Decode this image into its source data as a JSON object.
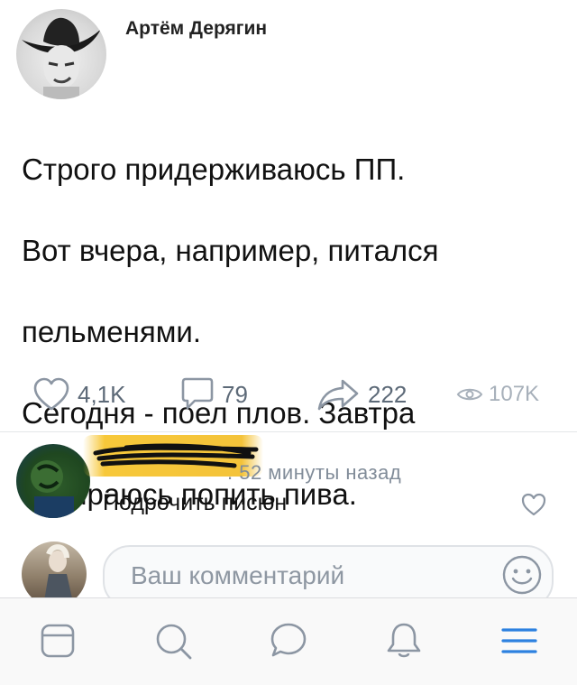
{
  "post": {
    "author": "Артём Дерягин",
    "text_lines": [
      "Строго придерживаюсь ПП.",
      "Вот вчера, например, питался",
      "пельменями.",
      "Сегодня - поел плов. Завтра",
      "собираюсь попить пива."
    ],
    "likes": "4,1K",
    "comments": "79",
    "shares": "222",
    "views": "107K"
  },
  "comment": {
    "time": ". 52 минуты назад",
    "text": "Подрочить писюн"
  },
  "composer": {
    "placeholder": "Ваш комментарий"
  },
  "tabbar": {
    "items": [
      "news-icon",
      "search-icon",
      "messages-icon",
      "notifications-icon",
      "menu-icon"
    ]
  },
  "colors": {
    "icon_gray": "#8c96a3",
    "accent_blue": "#2d81e0",
    "redaction": "#f5c53b"
  }
}
